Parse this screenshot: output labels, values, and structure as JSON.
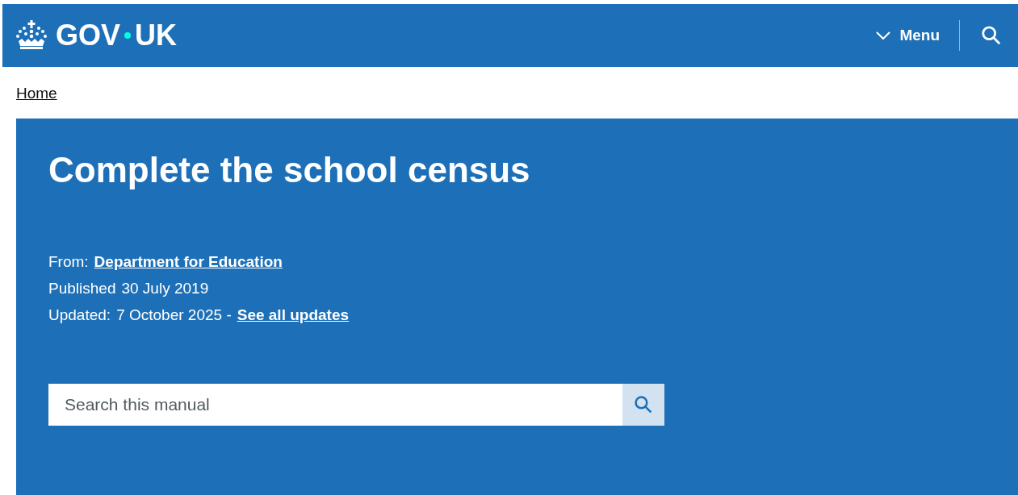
{
  "header": {
    "logo": "GOV",
    "logo_suffix": "UK",
    "menu": "Menu"
  },
  "breadcrumbs": [
    {
      "label": "Home"
    }
  ],
  "title": "Complete the school census",
  "meta": [
    {
      "label": "From:",
      "value": "Department for Education",
      "kind": "link"
    },
    {
      "label": "Published",
      "value": "30 July 2019",
      "kind": "text"
    },
    {
      "label": "Updated:",
      "value": "7 October 2025 -",
      "link": "See all updates",
      "kind": "text-link"
    }
  ],
  "search": {
    "placeholder": "Search this manual"
  }
}
